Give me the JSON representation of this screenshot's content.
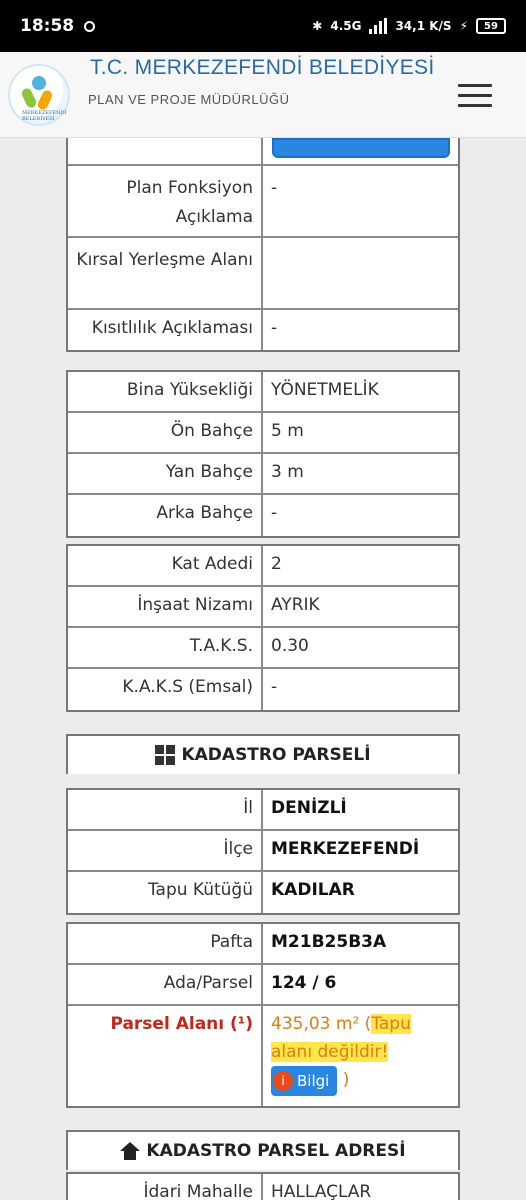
{
  "status_bar": {
    "time": "18:58",
    "network": "4.5G",
    "speed": "34,1 K/S",
    "battery": "59"
  },
  "header": {
    "title": "T.C. MERKEZEFENDİ BELEDİYESİ",
    "subtitle": "PLAN VE PROJE MÜDÜRLÜĞÜ",
    "logo_text": "MERKEZEFENDİ BELEDİYESİ"
  },
  "table1": {
    "rows": [
      {
        "label": "Plan Fonksiyon Açıklama",
        "value": "-"
      },
      {
        "label": "Kırsal Yerleşme Alanı",
        "value": ""
      },
      {
        "label": "Kısıtlılık Açıklaması",
        "value": "-"
      }
    ]
  },
  "table2": {
    "rows": [
      {
        "label": "Bina Yüksekliği",
        "value": "YÖNETMELİK"
      },
      {
        "label": "Ön Bahçe",
        "value": "5 m"
      },
      {
        "label": "Yan Bahçe",
        "value": "3 m"
      },
      {
        "label": "Arka Bahçe",
        "value": "-"
      }
    ]
  },
  "table3": {
    "rows": [
      {
        "label": "Kat Adedi",
        "value": "2"
      },
      {
        "label": "İnşaat Nizamı",
        "value": "AYRIK"
      },
      {
        "label": "T.A.K.S.",
        "value": "0.30"
      },
      {
        "label": "K.A.K.S (Emsal)",
        "value": "-"
      }
    ]
  },
  "kadastro": {
    "header": "KADASTRO PARSELİ",
    "table_a": [
      {
        "label": "İl",
        "value": "DENİZLİ"
      },
      {
        "label": "İlçe",
        "value": "MERKEZEFENDİ"
      },
      {
        "label": "Tapu Kütüğü",
        "value": "KADILAR"
      }
    ],
    "table_b": [
      {
        "label": "Pafta",
        "value": "M21B25B3A"
      },
      {
        "label": "Ada/Parsel",
        "value": "124 / 6"
      }
    ],
    "parsel_alani": {
      "label": "Parsel Alanı (¹)",
      "value": "435,03 m²",
      "open_paren": "(",
      "note": "Tapu alanı değildir!",
      "button": "Bilgi",
      "close_paren": ")"
    }
  },
  "adres": {
    "header": "KADASTRO PARSEL ADRESİ",
    "rows": [
      {
        "label": "İdari Mahalle",
        "value": "HALLAÇLAR"
      }
    ]
  }
}
